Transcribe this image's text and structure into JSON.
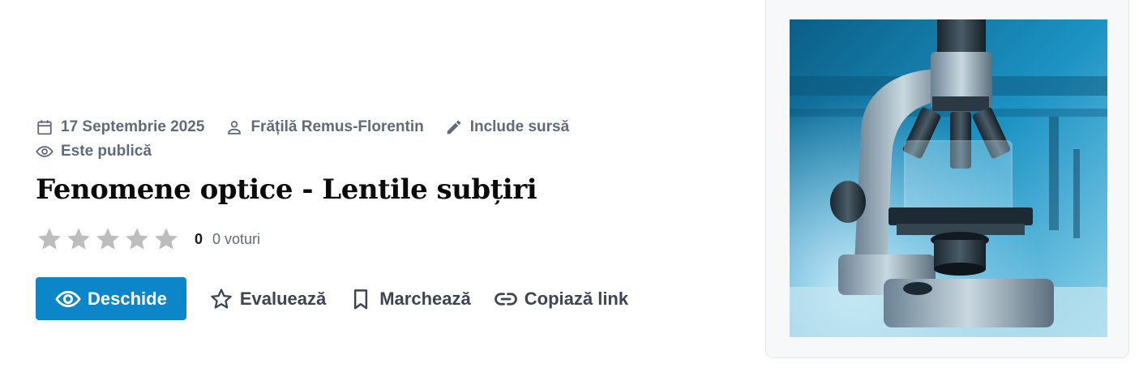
{
  "meta": {
    "date": "17 Septembrie 2025",
    "author": "Frățilă Remus-Florentin",
    "source": "Include sursă",
    "visibility": "Este publică"
  },
  "title": "Fenomene optice - Lentile subțiri",
  "rating": {
    "value": "0",
    "votes": "0 voturi",
    "stars_total": 5,
    "stars_filled": 0
  },
  "actions": {
    "open": "Deschide",
    "rate": "Evaluează",
    "bookmark": "Marchează",
    "copy_link": "Copiază link"
  },
  "icons": {
    "date": "calendar-icon",
    "author": "user-icon",
    "source": "pencil-icon",
    "visibility": "eye-icon",
    "open": "eye-icon",
    "rate": "star-outline-icon",
    "bookmark": "bookmark-icon",
    "copy_link": "link-icon"
  },
  "colors": {
    "primary": "#0a86c9",
    "meta_text": "#5f6b7a",
    "star_empty": "#bdbdbd"
  },
  "image": {
    "subject": "microscope"
  }
}
